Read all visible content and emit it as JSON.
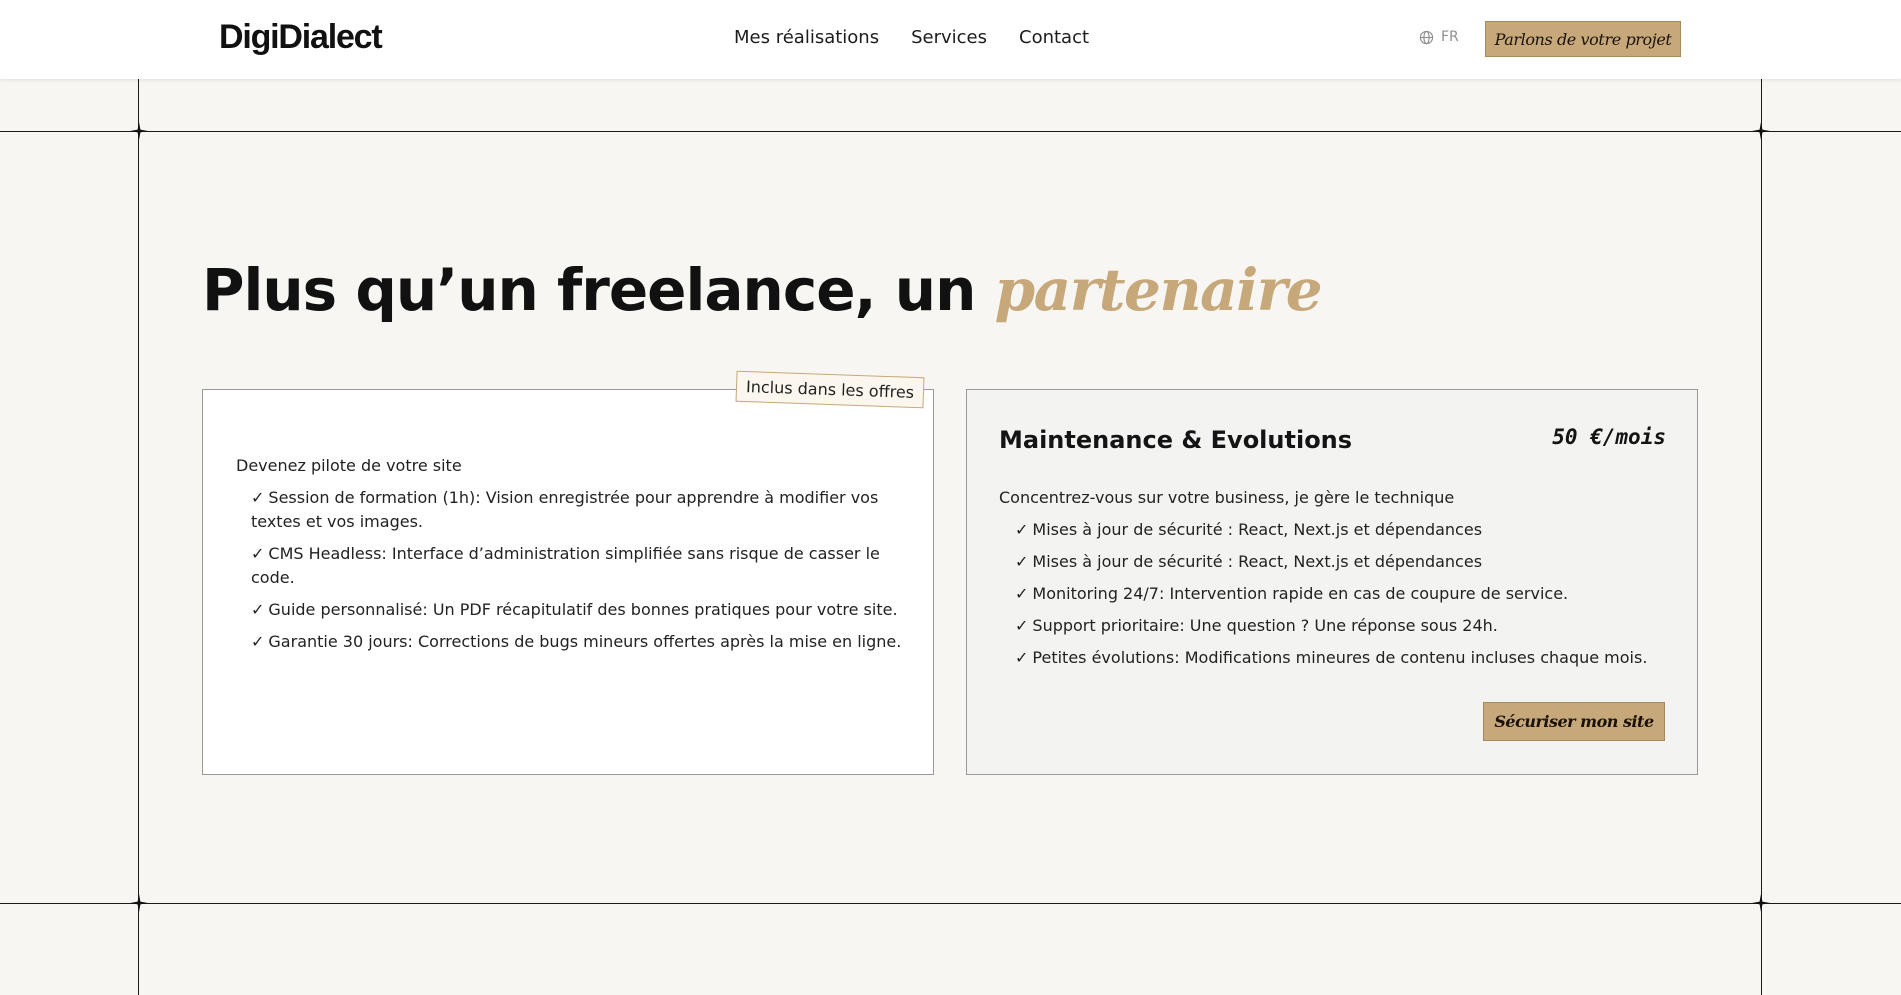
{
  "brand": {
    "logo": "DigiDialect"
  },
  "nav": {
    "items": [
      "Mes réalisations",
      "Services",
      "Contact"
    ]
  },
  "lang": {
    "label": "FR",
    "icon": "globe-icon"
  },
  "header_cta": {
    "label": "Parlons de votre projet"
  },
  "hero": {
    "title_plain": "Plus qu’un freelance, un ",
    "title_accent": "partenaire"
  },
  "colors": {
    "accent": "#c6a87a",
    "background": "#f8f6f2",
    "card_alt": "#f3f3f2"
  },
  "included_card": {
    "badge": "Inclus dans les offres",
    "intro": "Devenez pilote de votre site",
    "items": [
      "Session de formation (1h): Vision enregistrée pour apprendre à modifier vos textes et vos images.",
      "CMS Headless: Interface d’administration simplifiée sans risque de casser le code.",
      "Guide personnalisé: Un PDF récapitulatif des bonnes pratiques pour votre site.",
      "Garantie 30 jours: Corrections de bugs mineurs offertes après la mise en ligne."
    ]
  },
  "maintenance_card": {
    "title": "Maintenance & Evolutions",
    "price": "50 €/mois",
    "intro": "Concentrez-vous sur votre business, je gère le technique",
    "items": [
      "Mises à jour de sécurité : React, Next.js et dépendances",
      "Mises à jour de sécurité : React, Next.js et dépendances",
      "Monitoring 24/7: Intervention rapide en cas de coupure de service.",
      "Support prioritaire: Une question ? Une réponse sous 24h.",
      "Petites évolutions: Modifications mineures de contenu incluses chaque mois."
    ],
    "cta": "Sécuriser mon site"
  },
  "check_glyph": "✓"
}
